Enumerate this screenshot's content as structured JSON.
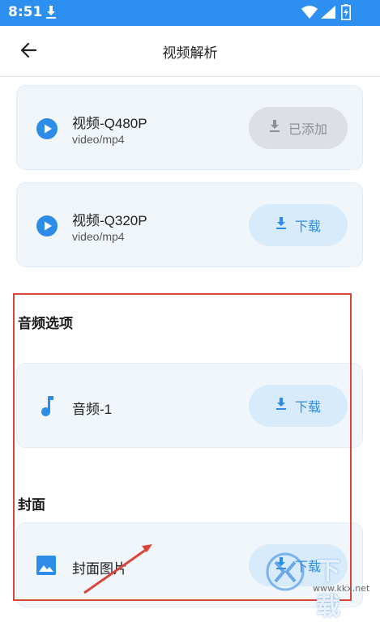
{
  "status_bar": {
    "time": "8:51",
    "icons": [
      "download-icon",
      "wifi-icon",
      "signal-icon",
      "battery-charging-icon"
    ]
  },
  "app_bar": {
    "title": "视频解析",
    "back_icon": "arrow-left-icon"
  },
  "video_options": [
    {
      "name": "视频-Q480P",
      "format": "video/mp4",
      "button_label": "已添加",
      "button_state": "added"
    },
    {
      "name": "视频-Q320P",
      "format": "video/mp4",
      "button_label": "下载",
      "button_state": "download"
    }
  ],
  "audio_section": {
    "title": "音频选项",
    "items": [
      {
        "name": "音频-1",
        "button_label": "下载"
      }
    ]
  },
  "cover_section": {
    "title": "封面",
    "items": [
      {
        "name": "封面图片",
        "button_label": "下载"
      }
    ]
  },
  "watermark": {
    "text": "下载",
    "url": "www.kkx.net"
  },
  "colors": {
    "status_bar": "#2d8ff0",
    "accent": "#2c8ce8",
    "card_bg": "#f1f6fb",
    "added_button_bg": "#dcdfe3",
    "download_button_bg": "#d8ebfb",
    "annotation": "#d8463a"
  }
}
